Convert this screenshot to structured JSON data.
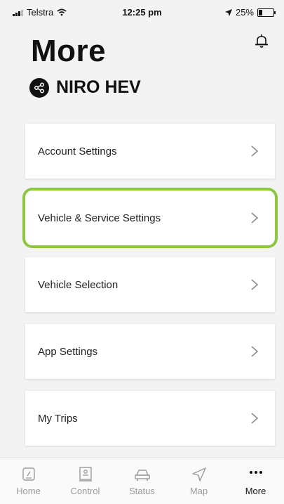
{
  "status_bar": {
    "carrier": "Telstra",
    "time": "12:25 pm",
    "battery": "25%",
    "battery_level": 0.25
  },
  "header": {
    "title": "More",
    "vehicle_name": "NIRO HEV"
  },
  "menu": [
    {
      "label": "Account Settings",
      "highlighted": false
    },
    {
      "label": "Vehicle & Service Settings",
      "highlighted": true
    },
    {
      "label": "Vehicle Selection",
      "highlighted": false
    },
    {
      "label": "App Settings",
      "highlighted": false
    },
    {
      "label": "My Trips",
      "highlighted": false
    }
  ],
  "tabs": [
    {
      "label": "Home",
      "icon": "home-icon"
    },
    {
      "label": "Control",
      "icon": "control-icon"
    },
    {
      "label": "Status",
      "icon": "car-icon"
    },
    {
      "label": "Map",
      "icon": "navigation-arrow-icon"
    },
    {
      "label": "More",
      "icon": "more-dots-icon",
      "active": true
    }
  ],
  "colors": {
    "highlight": "#8dc63f",
    "background": "#f3f3f3",
    "inactive_tab": "#9a9a9a"
  }
}
